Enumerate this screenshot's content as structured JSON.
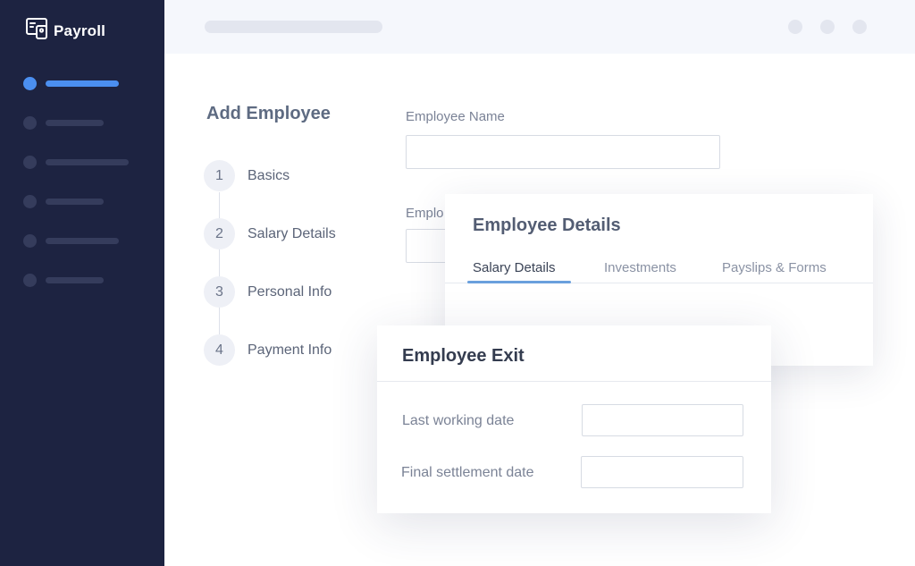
{
  "app": {
    "name": "Payroll"
  },
  "colors": {
    "sidebar_bg": "#1d2341",
    "accent": "#4b8ff0",
    "topbar_bg": "#f5f7fc"
  },
  "icons": {
    "brand": "payroll-card-icon"
  },
  "sidebar": {
    "items": [
      {
        "active": true
      },
      {
        "active": false
      },
      {
        "active": false
      },
      {
        "active": false
      },
      {
        "active": false
      },
      {
        "active": false
      }
    ]
  },
  "topbar": {
    "action_dots": 3
  },
  "add_employee": {
    "title": "Add Employee",
    "steps": [
      {
        "number": "1",
        "label": "Basics"
      },
      {
        "number": "2",
        "label": "Salary Details"
      },
      {
        "number": "3",
        "label": "Personal Info"
      },
      {
        "number": "4",
        "label": "Payment Info"
      }
    ],
    "fields": {
      "employee_name_label": "Employee Name",
      "employee_name_value": "",
      "second_label_partial": "Emplo",
      "second_value": ""
    }
  },
  "employee_details": {
    "title": "Employee Details",
    "tabs": [
      {
        "label": "Salary Details",
        "active": true
      },
      {
        "label": "Investments",
        "active": false
      },
      {
        "label": "Payslips & Forms",
        "active": false
      }
    ]
  },
  "employee_exit": {
    "title": "Employee Exit",
    "last_working_date_label": "Last working date",
    "last_working_date_value": "",
    "final_settlement_date_label": "Final settlement date",
    "final_settlement_date_value": ""
  }
}
